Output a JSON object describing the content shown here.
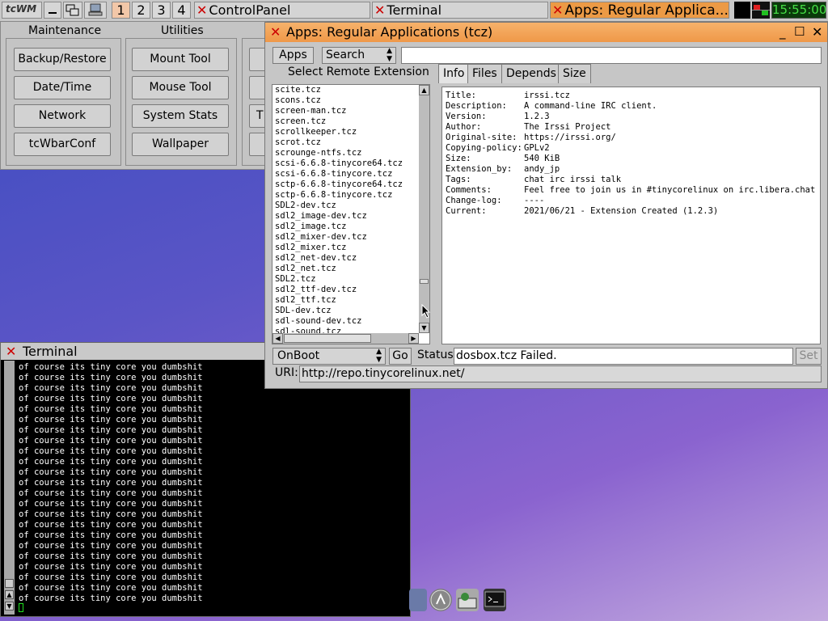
{
  "taskbar": {
    "logo": "tcWM",
    "workspaces": [
      "1",
      "2",
      "3",
      "4"
    ],
    "active_workspace": "1",
    "tasks": [
      "ControlPanel",
      "Terminal",
      "Apps: Regular Applica..."
    ],
    "clock": "15:55:00"
  },
  "control_panel": {
    "groups": [
      {
        "title": "Maintenance",
        "buttons": [
          "Backup/Restore",
          "Date/Time",
          "Network",
          "tcWbarConf"
        ]
      },
      {
        "title": "Utilities",
        "buttons": [
          "Mount Tool",
          "Mouse Tool",
          "System Stats",
          "Wallpaper"
        ]
      }
    ],
    "partial_third_col": [
      "T"
    ]
  },
  "apps_window": {
    "title": "Apps: Regular Applications (tcz)",
    "menu_apps": "Apps",
    "search_select": "Search",
    "search_value": "",
    "list_label": "Select Remote Extension",
    "extensions": [
      "scite.tcz",
      "scons.tcz",
      "screen-man.tcz",
      "screen.tcz",
      "scrollkeeper.tcz",
      "scrot.tcz",
      "scrounge-ntfs.tcz",
      "scsi-6.6.8-tinycore64.tcz",
      "scsi-6.6.8-tinycore.tcz",
      "sctp-6.6.8-tinycore64.tcz",
      "sctp-6.6.8-tinycore.tcz",
      "SDL2-dev.tcz",
      "sdl2_image-dev.tcz",
      "sdl2_image.tcz",
      "sdl2_mixer-dev.tcz",
      "sdl2_mixer.tcz",
      "sdl2_net-dev.tcz",
      "sdl2_net.tcz",
      "SDL2.tcz",
      "sdl2_ttf-dev.tcz",
      "sdl2_ttf.tcz",
      "SDL-dev.tcz",
      "sdl-sound-dev.tcz",
      "sdl-sound.tcz"
    ],
    "tabs": [
      "Info",
      "Files",
      "Depends",
      "Size"
    ],
    "active_tab": "Info",
    "info": [
      {
        "k": "Title:",
        "v": "irssi.tcz"
      },
      {
        "k": "Description:",
        "v": "A command-line IRC client."
      },
      {
        "k": "Version:",
        "v": "1.2.3"
      },
      {
        "k": "Author:",
        "v": "The Irssi Project"
      },
      {
        "k": "Original-site:",
        "v": "https://irssi.org/"
      },
      {
        "k": "Copying-policy:",
        "v": "GPLv2"
      },
      {
        "k": "Size:",
        "v": "540 KiB"
      },
      {
        "k": "Extension_by:",
        "v": "andy_jp"
      },
      {
        "k": "Tags:",
        "v": "chat irc irssi talk"
      },
      {
        "k": "Comments:",
        "v": "Feel free to join us in #tinycorelinux on irc.libera.chat"
      },
      {
        "k": "Change-log:",
        "v": "----"
      },
      {
        "k": "Current:",
        "v": "2021/06/21 - Extension Created (1.2.3)"
      }
    ],
    "install_mode": "OnBoot",
    "go": "Go",
    "status_label": "Status",
    "status_value": "dosbox.tcz Failed.",
    "set": "Set",
    "uri_label": "URI:",
    "uri_value": "http://repo.tinycorelinux.net/"
  },
  "terminal": {
    "title": "Terminal",
    "lines": [
      "of course its tiny core you dumbshit",
      "of course its tiny core you dumbshit",
      "of course its tiny core you dumbshit",
      "of course its tiny core you dumbshit",
      "of course its tiny core you dumbshit",
      "of course its tiny core you dumbshit",
      "of course its tiny core you dumbshit",
      "of course its tiny core you dumbshit",
      "of course its tiny core you dumbshit",
      "of course its tiny core you dumbshit",
      "of course its tiny core you dumbshit",
      "of course its tiny core you dumbshit",
      "of course its tiny core you dumbshit",
      "of course its tiny core you dumbshit",
      "of course its tiny core you dumbshit",
      "of course its tiny core you dumbshit",
      "of course its tiny core you dumbshit",
      "of course its tiny core you dumbshit",
      "of course its tiny core you dumbshit",
      "of course its tiny core you dumbshit",
      "of course its tiny core you dumbshit",
      "of course its tiny core you dumbshit",
      "of course its tiny core you dumbshit"
    ]
  },
  "colors": {
    "active_title": "#ef9848",
    "desktop_top": "#3a4cc0",
    "desktop_bottom": "#c3aadf",
    "clock_bg": "#0a3a0a",
    "clock_fg": "#46e046"
  }
}
